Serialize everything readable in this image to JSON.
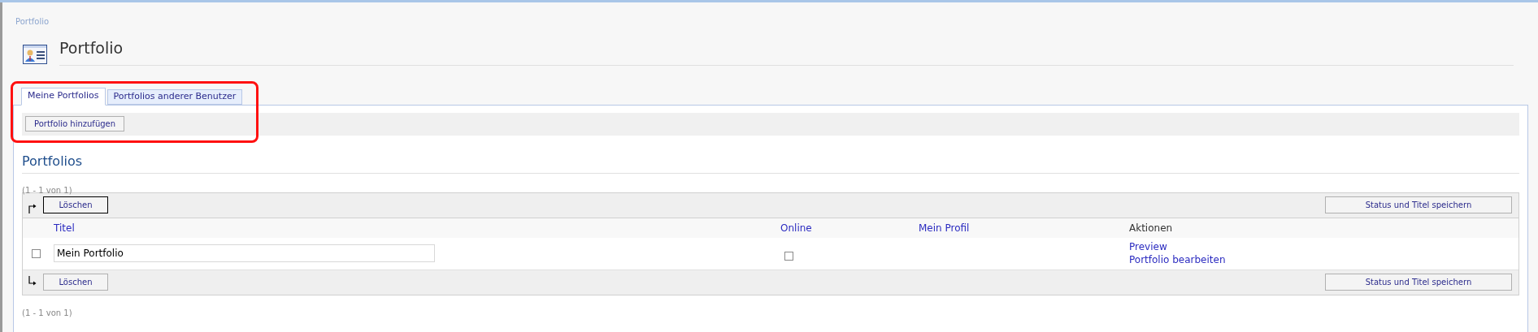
{
  "breadcrumb": "Portfolio",
  "title": "Portfolio",
  "tabs": [
    {
      "label": "Meine Portfolios",
      "selected": true
    },
    {
      "label": "Portfolios anderer Benutzer",
      "selected": false
    }
  ],
  "add_button": "Portfolio hinzufügen",
  "section": {
    "heading": "Portfolios",
    "count_top": "(1 - 1 von 1)",
    "count_bottom": "(1 - 1 von 1)"
  },
  "table": {
    "top_bar": {
      "delete_button": "Löschen",
      "save_button": "Status und Titel speichern"
    },
    "columns": [
      "Titel",
      "Online",
      "Mein Profil",
      "Aktionen"
    ],
    "rows": [
      {
        "checked": false,
        "title": "Mein Portfolio",
        "online": false,
        "actions": [
          "Preview",
          "Portfolio bearbeiten"
        ]
      }
    ],
    "bottom_bar": {
      "delete_button": "Löschen",
      "save_button": "Status und Titel speichern"
    }
  }
}
